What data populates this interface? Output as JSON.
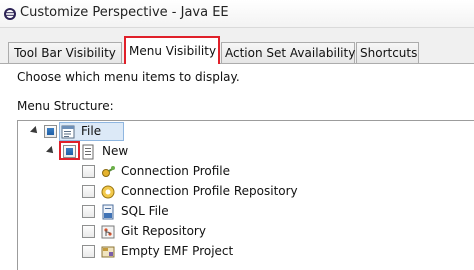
{
  "window": {
    "title": "Customize Perspective - Java EE"
  },
  "tabs": [
    {
      "label": "Tool Bar Visibility",
      "active": false
    },
    {
      "label": "Menu Visibility",
      "active": true
    },
    {
      "label": "Action Set Availability",
      "active": false
    },
    {
      "label": "Shortcuts",
      "active": false
    }
  ],
  "pane": {
    "instruction": "Choose which menu items to display.",
    "section_label": "Menu Structure:"
  },
  "tree": {
    "items": [
      {
        "label": "File",
        "icon": "menu-icon",
        "expanded": true,
        "checked": "partial"
      },
      {
        "label": "New",
        "icon": "submenu-icon",
        "expanded": true,
        "checked": "partial"
      },
      {
        "label": "Connection Profile",
        "icon": "connection-profile-icon",
        "checked": false
      },
      {
        "label": "Connection Profile Repository",
        "icon": "connection-profile-repository-icon",
        "checked": false
      },
      {
        "label": "SQL File",
        "icon": "sql-file-icon",
        "checked": false
      },
      {
        "label": "Git Repository",
        "icon": "git-repository-icon",
        "checked": false
      },
      {
        "label": "Empty EMF Project",
        "icon": "emf-project-icon",
        "checked": false
      }
    ]
  },
  "colors": {
    "highlight_red": "#e0202a",
    "selection_blue": "#dce9f7",
    "check_blue": "#2b6db5"
  }
}
